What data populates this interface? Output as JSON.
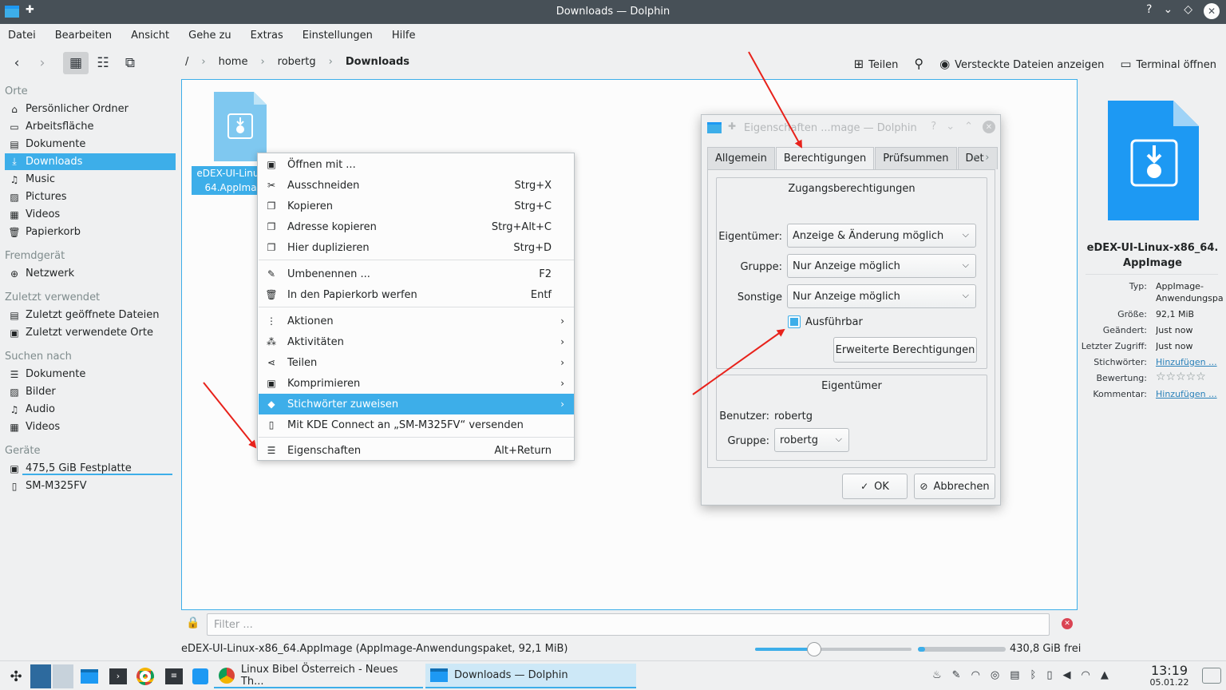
{
  "window": {
    "title": "Downloads — Dolphin",
    "controls": [
      "?",
      "⌄",
      "◇"
    ]
  },
  "menubar": [
    "Datei",
    "Bearbeiten",
    "Ansicht",
    "Gehe zu",
    "Extras",
    "Einstellungen",
    "Hilfe"
  ],
  "breadcrumb": {
    "root": "/",
    "items": [
      "home",
      "robertg",
      "Downloads"
    ]
  },
  "toolbar_right": {
    "share": "Teilen",
    "hidden_files": "Versteckte Dateien anzeigen",
    "terminal": "Terminal öffnen"
  },
  "sidebar": {
    "places_head": "Orte",
    "places": [
      {
        "label": "Persönlicher Ordner",
        "icon": "home-icon"
      },
      {
        "label": "Arbeitsfläche",
        "icon": "desktop-icon"
      },
      {
        "label": "Dokumente",
        "icon": "document-icon"
      },
      {
        "label": "Downloads",
        "icon": "download-icon",
        "selected": true
      },
      {
        "label": "Music",
        "icon": "music-icon"
      },
      {
        "label": "Pictures",
        "icon": "picture-icon"
      },
      {
        "label": "Videos",
        "icon": "video-icon"
      },
      {
        "label": "Papierkorb",
        "icon": "trash-icon"
      }
    ],
    "remote_head": "Fremdgerät",
    "remote": [
      {
        "label": "Netzwerk",
        "icon": "network-icon"
      }
    ],
    "recent_head": "Zuletzt verwendet",
    "recent": [
      {
        "label": "Zuletzt geöffnete Dateien",
        "icon": "recent-files-icon"
      },
      {
        "label": "Zuletzt verwendete Orte",
        "icon": "recent-places-icon"
      }
    ],
    "search_head": "Suchen nach",
    "search": [
      {
        "label": "Dokumente",
        "icon": "document-icon"
      },
      {
        "label": "Bilder",
        "icon": "picture-icon"
      },
      {
        "label": "Audio",
        "icon": "music-icon"
      },
      {
        "label": "Videos",
        "icon": "video-icon"
      }
    ],
    "devices_head": "Geräte",
    "devices": [
      {
        "label": "475,5 GiB Festplatte",
        "icon": "harddisk-icon"
      },
      {
        "label": "SM-M325FV",
        "icon": "phone-icon"
      }
    ]
  },
  "file": {
    "label_line1": "eDEX-UI-Linux",
    "label_line2": "64.AppIma"
  },
  "context_menu": {
    "group1": [
      {
        "label": "Öffnen mit ...",
        "shortcut": "",
        "icon": "open-with-icon"
      },
      {
        "label": "Ausschneiden",
        "shortcut": "Strg+X",
        "icon": "cut-icon"
      },
      {
        "label": "Kopieren",
        "shortcut": "Strg+C",
        "icon": "copy-icon"
      },
      {
        "label": "Adresse kopieren",
        "shortcut": "Strg+Alt+C",
        "icon": "copy-location-icon"
      },
      {
        "label": "Hier duplizieren",
        "shortcut": "Strg+D",
        "icon": "duplicate-icon"
      }
    ],
    "group2": [
      {
        "label": "Umbenennen ...",
        "shortcut": "F2",
        "icon": "rename-icon"
      },
      {
        "label": "In den Papierkorb werfen",
        "shortcut": "Entf",
        "icon": "trash-icon"
      }
    ],
    "group3": [
      {
        "label": "Aktionen",
        "icon": "actions-icon"
      },
      {
        "label": "Aktivitäten",
        "icon": "activities-icon"
      },
      {
        "label": "Teilen",
        "icon": "share-icon"
      },
      {
        "label": "Komprimieren",
        "icon": "compress-icon"
      },
      {
        "label": "Stichwörter zuweisen",
        "icon": "tag-icon",
        "highlighted": true
      }
    ],
    "kde_connect": "Mit KDE Connect an „SM-M325FV“ versenden",
    "properties": {
      "label": "Eigenschaften",
      "shortcut": "Alt+Return"
    }
  },
  "dialog": {
    "title": "Eigenschaften ...mage — Dolphin",
    "tabs": [
      "Allgemein",
      "Berechtigungen",
      "Prüfsummen",
      "Det"
    ],
    "access_title": "Zugangsberechtigungen",
    "owner_label": "Eigentümer:",
    "owner_value": "Anzeige & Änderung möglich",
    "group_label": "Gruppe:",
    "group_value": "Nur Anzeige möglich",
    "others_label": "Sonstige",
    "others_value": "Nur Anzeige möglich",
    "executable_label": "Ausführbar",
    "executable_checked": true,
    "advanced_button": "Erweiterte Berechtigungen",
    "ownership_title": "Eigentümer",
    "user_label": "Benutzer:",
    "user_value": "robertg",
    "group2_label": "Gruppe:",
    "group2_value": "robertg",
    "ok": "OK",
    "cancel": "Abbrechen"
  },
  "info_panel": {
    "name_line1": "eDEX-UI-Linux-x86_64.",
    "name_line2": "AppImage",
    "meta": [
      {
        "key": "Typ:",
        "value": "AppImage-",
        "value2": "Anwendungspa"
      },
      {
        "key": "Größe:",
        "value": "92,1 MiB"
      },
      {
        "key": "Geändert:",
        "value": "Just now"
      },
      {
        "key": "Letzter Zugriff:",
        "value": "Just now"
      },
      {
        "key": "Stichwörter:",
        "value": "Hinzufügen ...",
        "link": true
      },
      {
        "key": "Bewertung:",
        "value": "☆☆☆☆☆"
      },
      {
        "key": "Kommentar:",
        "value": "Hinzufügen ...",
        "link": true
      }
    ]
  },
  "filter": {
    "placeholder": "Filter ..."
  },
  "status": {
    "text": "eDEX-UI-Linux-x86_64.AppImage (AppImage-Anwendungspaket, 92,1 MiB)",
    "zoom_fraction": 0.38,
    "free_fraction": 0.08,
    "free_text": "430,8 GiB frei"
  },
  "taskbar": {
    "windows": [
      {
        "label": "Linux Bibel Österreich - Neues Th...",
        "active": false
      },
      {
        "label": "Downloads — Dolphin",
        "active": true
      }
    ],
    "time": "13:19",
    "date": "05.01.22"
  },
  "colors": {
    "accent": "#3daee9",
    "titlebar": "#475057",
    "annotation_arrow": "#e8221b"
  }
}
